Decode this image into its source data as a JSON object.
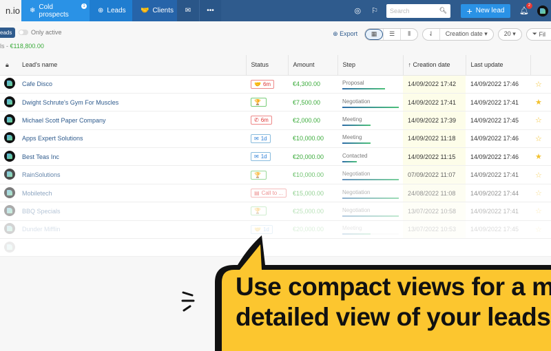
{
  "nav": {
    "logo": "n.io",
    "tabs": [
      {
        "label": "Cold prospects",
        "badge": "1",
        "icon": "snowflake-icon"
      },
      {
        "label": "Leads",
        "icon": "crosshair-icon"
      },
      {
        "label": "Clients",
        "icon": "handshake-icon"
      },
      {
        "icon": "mail-icon"
      },
      {
        "icon": "more-icon"
      }
    ],
    "search_placeholder": "Search",
    "new_lead": "New lead",
    "notif_count": "2"
  },
  "filters": {
    "pill": "eads",
    "only_active": "Only active",
    "total_prefix": "ls - ",
    "total_amount": "€118,800.00"
  },
  "toolbar": {
    "export": "Export",
    "sort_field": "Creation date ▾",
    "page_size": "20 ▾",
    "filter": "Fil"
  },
  "columns": {
    "name": "Lead's name",
    "status": "Status",
    "amount": "Amount",
    "step": "Step",
    "creation": "Creation date",
    "update": "Last update"
  },
  "rows": [
    {
      "name": "Cafe Disco",
      "status": "6m",
      "status_type": "red",
      "status_icon": "handshake-icon",
      "amount": "€4,300.00",
      "step": "Proposal",
      "progress": 0.75,
      "created": "14/09/2022 17:42",
      "updated": "14/09/2022 17:46",
      "starred": false
    },
    {
      "name": "Dwight Schrute's Gym For Muscles",
      "status": "",
      "status_type": "green",
      "status_icon": "trophy-icon",
      "amount": "€7,500.00",
      "step": "Negotiation",
      "progress": 1,
      "created": "14/09/2022 17:41",
      "updated": "14/09/2022 17:41",
      "starred": true
    },
    {
      "name": "Michael Scott Paper Company",
      "status": "6m",
      "status_type": "red",
      "status_icon": "phone-icon",
      "amount": "€2,000.00",
      "step": "Meeting",
      "progress": 0.5,
      "created": "14/09/2022 17:39",
      "updated": "14/09/2022 17:45",
      "starred": false
    },
    {
      "name": "Apps Expert Solutions",
      "status": "1d",
      "status_type": "blue",
      "status_icon": "mail-icon",
      "amount": "€10,000.00",
      "step": "Meeting",
      "progress": 0.5,
      "created": "14/09/2022 11:18",
      "updated": "14/09/2022 17:46",
      "starred": false
    },
    {
      "name": "Best Teas Inc",
      "status": "1d",
      "status_type": "blue",
      "status_icon": "mail-icon",
      "amount": "€20,000.00",
      "step": "Contacted",
      "progress": 0.25,
      "created": "14/09/2022 11:15",
      "updated": "14/09/2022 17:46",
      "starred": true
    },
    {
      "name": "RainSolutions",
      "status": "",
      "status_type": "green",
      "status_icon": "trophy-icon",
      "amount": "€10,000.00",
      "step": "Negotiation",
      "progress": 1,
      "created": "07/09/2022 11:07",
      "updated": "14/09/2022 17:41",
      "starred": false
    },
    {
      "name": "Mobiletech",
      "status": "Call to ...",
      "status_type": "red",
      "status_icon": "document-icon",
      "amount": "€15,000.00",
      "step": "Negotiation",
      "progress": 1,
      "created": "24/08/2022 11:08",
      "updated": "14/09/2022 17:44",
      "starred": false
    },
    {
      "name": "BBQ Specials",
      "status": "",
      "status_type": "green",
      "status_icon": "trophy-icon",
      "amount": "€25,000.00",
      "step": "Negotiation",
      "progress": 1,
      "created": "13/07/2022 10:58",
      "updated": "14/09/2022 17:41",
      "starred": false
    },
    {
      "name": "Dunder Mifflin",
      "status": "1d",
      "status_type": "blue",
      "status_icon": "handshake-icon",
      "amount": "€20,000.00",
      "step": "Meeting",
      "progress": 0.5,
      "created": "13/07/2022 10:53",
      "updated": "14/09/2022 17:45",
      "starred": false
    }
  ],
  "callout": {
    "line1": "Use compact views for a mo",
    "line2": "detailed view of your leads",
    "color": "#fcc62f"
  }
}
